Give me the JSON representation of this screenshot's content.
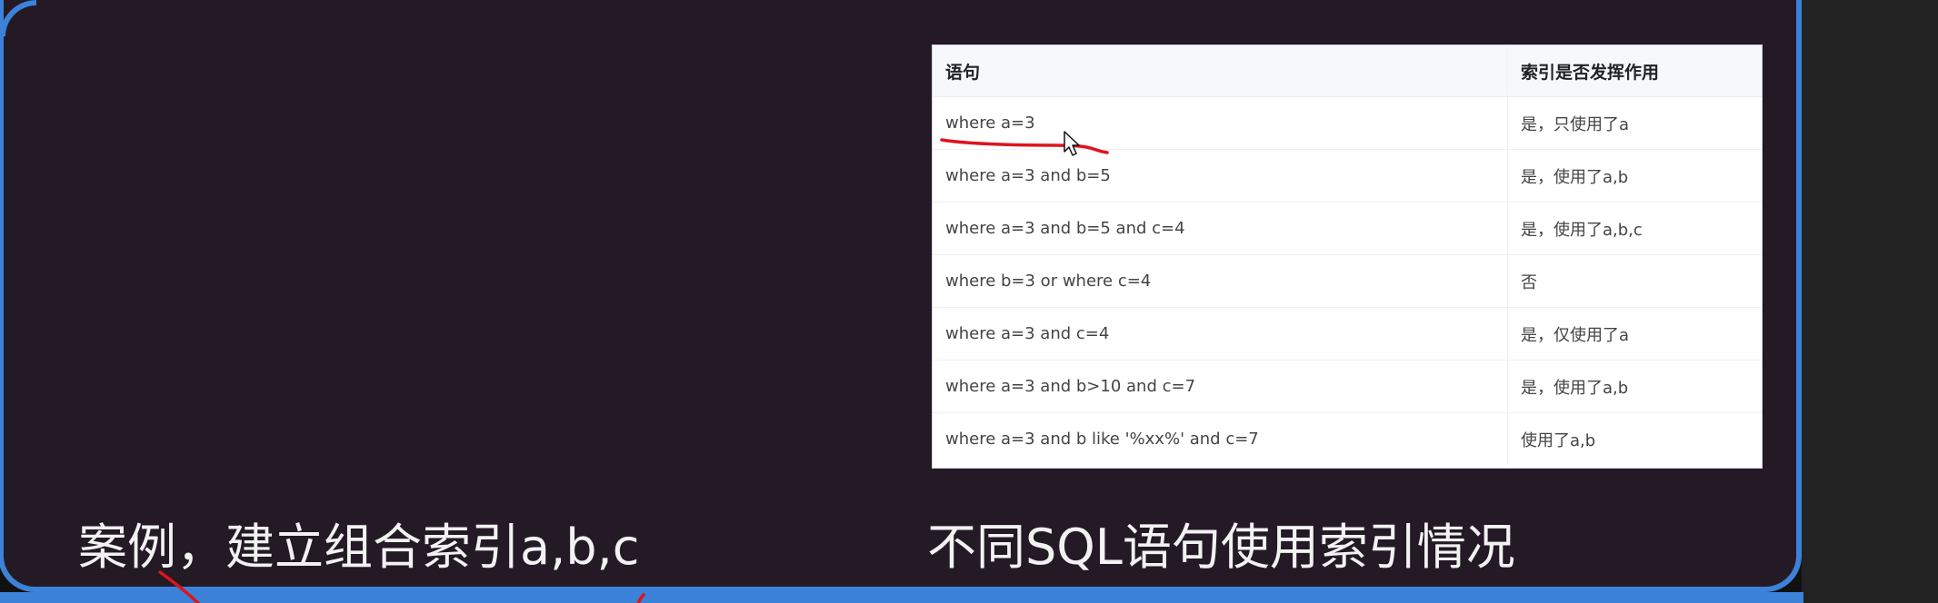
{
  "table": {
    "headers": [
      "语句",
      "索引是否发挥作用"
    ],
    "rows": [
      [
        "where a=3",
        "是，只使用了a"
      ],
      [
        "where a=3 and b=5",
        "是，使用了a,b"
      ],
      [
        "where a=3 and b=5 and c=4",
        "是，使用了a,b,c"
      ],
      [
        "where b=3 or where c=4",
        "否"
      ],
      [
        "where a=3 and c=4",
        "是，仅使用了a"
      ],
      [
        "where a=3 and b>10 and c=7",
        "是，使用了a,b"
      ],
      [
        "where a=3 and b like '%xx%' and c=7",
        "使用了a,b"
      ]
    ]
  },
  "captions": {
    "left": "案例，建立组合索引a,b,c",
    "right": "不同SQL语句使用索引情况"
  },
  "colors": {
    "background": "#231a25",
    "frame": "#3b82d8",
    "annotation": "#e0131c"
  },
  "icons": [
    "mouse-pointer-icon"
  ]
}
